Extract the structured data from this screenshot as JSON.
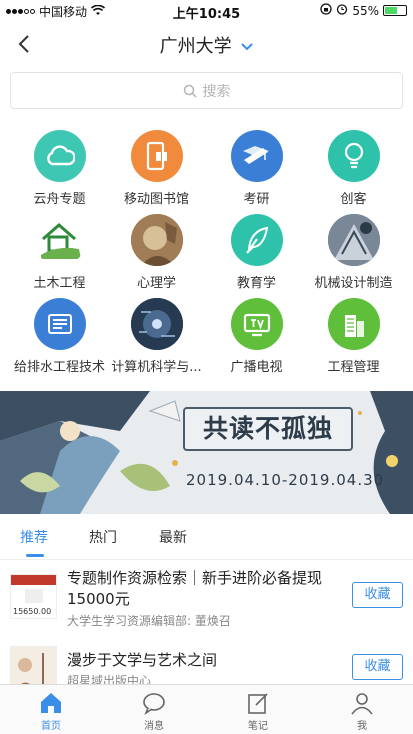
{
  "status_bar": {
    "carrier": "中国移动",
    "time": "上午10:45",
    "battery": "55%"
  },
  "nav": {
    "title": "广州大学"
  },
  "search": {
    "placeholder": "搜索"
  },
  "grid": [
    {
      "label": "云舟专题",
      "icon": "cloud-icon",
      "color": "#3ec7b3"
    },
    {
      "label": "移动图书馆",
      "icon": "mobile-book-icon",
      "color": "#f08a3c"
    },
    {
      "label": "考研",
      "icon": "graduation-icon",
      "color": "#3a7fd5"
    },
    {
      "label": "创客",
      "icon": "lightbulb-icon",
      "color": "#2fc2ab"
    },
    {
      "label": "土木工程",
      "icon": "house-hand-icon",
      "color": "#ffffff"
    },
    {
      "label": "心理学",
      "icon": "psychology-image-icon",
      "color": "#b99266"
    },
    {
      "label": "教育学",
      "icon": "feather-icon",
      "color": "#2fc2ab"
    },
    {
      "label": "机械设计制造",
      "icon": "machine-image-icon",
      "color": "#6e7c8c"
    },
    {
      "label": "给排水工程技术",
      "icon": "newspaper-icon",
      "color": "#3a7fd5"
    },
    {
      "label": "计算机科学与...",
      "icon": "computer-image-icon",
      "color": "#2d3e55"
    },
    {
      "label": "广播电视",
      "icon": "tv-icon",
      "color": "#5fbe3a"
    },
    {
      "label": "工程管理",
      "icon": "building-icon",
      "color": "#5fbe3a"
    }
  ],
  "banner": {
    "title": "共读不孤独",
    "date": "2019.04.10-2019.04.30"
  },
  "tabs": [
    "推荐",
    "热门",
    "最新"
  ],
  "list": [
    {
      "title": "专题制作资源检索｜新手进阶必备提现15000元",
      "subtitle": "大学生学习资源编辑部: 董焕召",
      "thumb_text": "15650.00",
      "button": "收藏"
    },
    {
      "title": "漫步于文学与艺术之间",
      "subtitle": "超星域出版中心",
      "thumb_text": "",
      "button": "收藏"
    }
  ],
  "bottom_tabs": [
    {
      "label": "首页",
      "icon": "home-icon"
    },
    {
      "label": "消息",
      "icon": "message-icon"
    },
    {
      "label": "笔记",
      "icon": "note-icon"
    },
    {
      "label": "我",
      "icon": "person-icon"
    }
  ],
  "colors": {
    "accent": "#3b8ee8"
  }
}
